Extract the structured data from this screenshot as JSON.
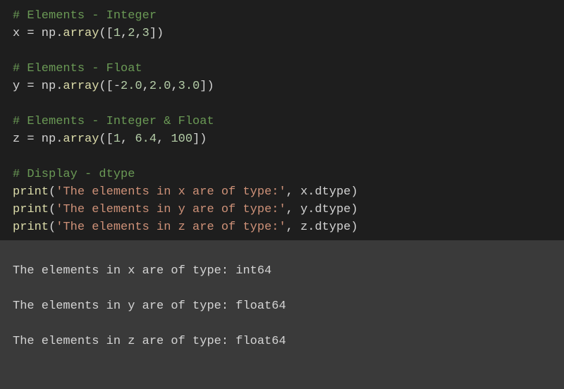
{
  "code": {
    "comment_int": "# Elements - Integer",
    "x_line": {
      "lhs": "x ",
      "eq": "=",
      "sp": " np",
      "dot": ".",
      "fn": "array",
      "open": "([",
      "n1": "1",
      "c1": ",",
      "n2": "2",
      "c2": ",",
      "n3": "3",
      "close": "])"
    },
    "blank1": "",
    "comment_float": "# Elements - Float",
    "y_line": {
      "lhs": "y ",
      "eq": "=",
      "sp": " np",
      "dot": ".",
      "fn": "array",
      "open": "([",
      "neg": "-",
      "n1": "2.0",
      "c1": ",",
      "n2": "2.0",
      "c2": ",",
      "n3": "3.0",
      "close": "])"
    },
    "blank2": "",
    "comment_mixed": "# Elements - Integer & Float",
    "z_line": {
      "lhs": "z ",
      "eq": "=",
      "sp": " np",
      "dot": ".",
      "fn": "array",
      "open": "([",
      "n1": "1",
      "c1": ", ",
      "n2": "6.4",
      "c2": ", ",
      "n3": "100",
      "close": "])"
    },
    "blank3": "",
    "comment_disp": "# Display - dtype",
    "print_x": {
      "fn": "print",
      "open": "(",
      "str": "'The elements in x are of type:'",
      "rest": ", x.dtype)"
    },
    "print_y": {
      "fn": "print",
      "open": "(",
      "str": "'The elements in y are of type:'",
      "rest": ", y.dtype)"
    },
    "print_z": {
      "fn": "print",
      "open": "(",
      "str": "'The elements in z are of type:'",
      "rest": ", z.dtype)"
    }
  },
  "output": {
    "line1": "The elements in x are of type: int64",
    "line2": "The elements in y are of type: float64",
    "line3": "The elements in z are of type: float64"
  }
}
